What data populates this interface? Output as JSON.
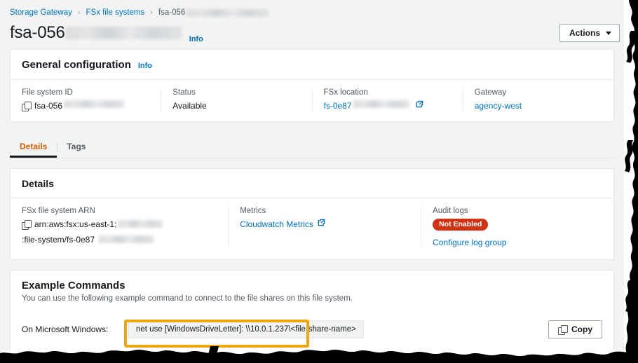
{
  "breadcrumb": {
    "items": [
      {
        "label": "Storage Gateway",
        "link": true
      },
      {
        "label": "FSx file systems",
        "link": true
      },
      {
        "label": "fsa-056",
        "link": false,
        "redacted": true
      }
    ],
    "separator": "›"
  },
  "header": {
    "title": "fsa-056",
    "info_label": "Info",
    "actions_label": "Actions"
  },
  "general_configuration": {
    "title": "General configuration",
    "info_label": "Info",
    "attributes": [
      {
        "label": "File system ID",
        "value": "fsa-056",
        "icon": "copy-icon",
        "redacted": true
      },
      {
        "label": "Status",
        "value": "Available"
      },
      {
        "label": "FSx location",
        "value": "fs-0e87",
        "link": true,
        "icon": "external-link-icon",
        "redacted": true
      },
      {
        "label": "Gateway",
        "value": "agency-west",
        "link": true
      }
    ]
  },
  "tabs": [
    {
      "label": "Details",
      "active": true
    },
    {
      "label": "Tags",
      "active": false
    }
  ],
  "details": {
    "title": "Details",
    "arn": {
      "label": "FSx file system ARN",
      "value_prefix": "arn:aws:fsx:us-east-1:",
      "value_suffix": ":file-system/fs-0e87",
      "icon": "copy-icon"
    },
    "metrics": {
      "label": "Metrics",
      "link_label": "Cloudwatch Metrics",
      "icon": "external-link-icon"
    },
    "audit_logs": {
      "label": "Audit logs",
      "badge": "Not Enabled",
      "link_label": "Configure log group"
    }
  },
  "example_commands": {
    "title": "Example Commands",
    "subtitle": "You can use the following example command to connect to the file shares on this file system.",
    "row_label": "On Microsoft Windows:",
    "command": "net use [WindowsDriveLetter]: \\\\10.0.1.237\\<file-share-name>",
    "copy_label": "Copy"
  },
  "colors": {
    "link": "#0073bb",
    "active_tab": "#d45b07",
    "badge_bg": "#d13212",
    "annotation": "#eda612",
    "page_bg": "#f2f3f3",
    "card_bg": "#ffffff"
  }
}
